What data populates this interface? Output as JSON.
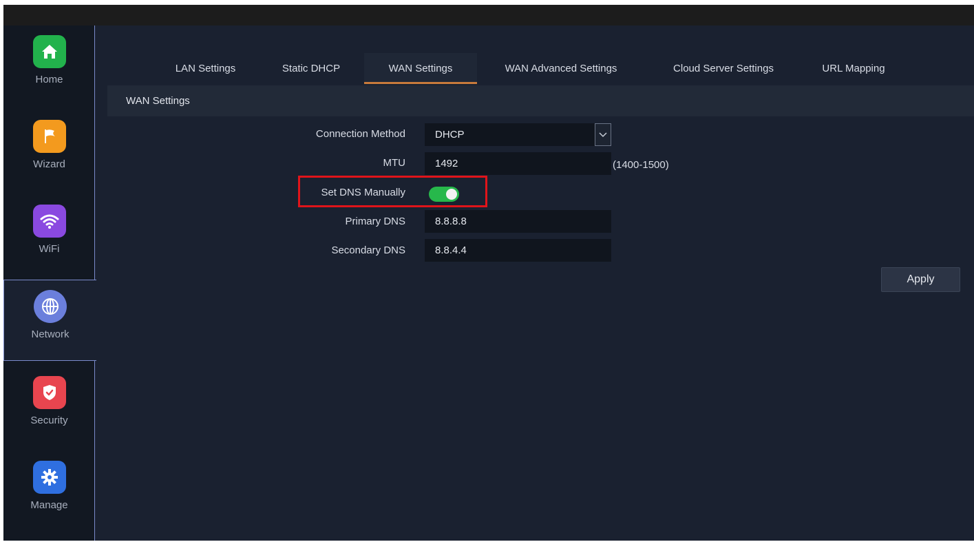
{
  "sidebar": {
    "items": [
      {
        "label": "Home",
        "icon": "home-icon",
        "color": "#22b24c"
      },
      {
        "label": "Wizard",
        "icon": "flag-icon",
        "color": "#f39a1e"
      },
      {
        "label": "WiFi",
        "icon": "wifi-icon",
        "color": "#8a49e0"
      },
      {
        "label": "Network",
        "icon": "globe-icon",
        "color": "#6b7fdc"
      },
      {
        "label": "Security",
        "icon": "shield-icon",
        "color": "#e8454f"
      },
      {
        "label": "Manage",
        "icon": "gear-icon",
        "color": "#2f6fe0"
      }
    ],
    "active": "Network"
  },
  "tabs": [
    {
      "label": "LAN Settings"
    },
    {
      "label": "Static DHCP"
    },
    {
      "label": "WAN Settings"
    },
    {
      "label": "WAN Advanced Settings"
    },
    {
      "label": "Cloud Server Settings"
    },
    {
      "label": "URL Mapping"
    }
  ],
  "active_tab": "WAN Settings",
  "section": {
    "title": "WAN Settings"
  },
  "form": {
    "connection_method": {
      "label": "Connection Method",
      "value": "DHCP"
    },
    "mtu": {
      "label": "MTU",
      "value": "1492",
      "hint": "(1400-1500)"
    },
    "set_dns_manually": {
      "label": "Set DNS Manually",
      "on": true
    },
    "primary_dns": {
      "label": "Primary DNS",
      "value": "8.8.8.8"
    },
    "secondary_dns": {
      "label": "Secondary DNS",
      "value": "8.8.4.4"
    }
  },
  "apply_label": "Apply",
  "colors": {
    "highlight": "#e0141a",
    "toggle_on": "#27b84b",
    "tab_underline": "#c87a3b"
  }
}
